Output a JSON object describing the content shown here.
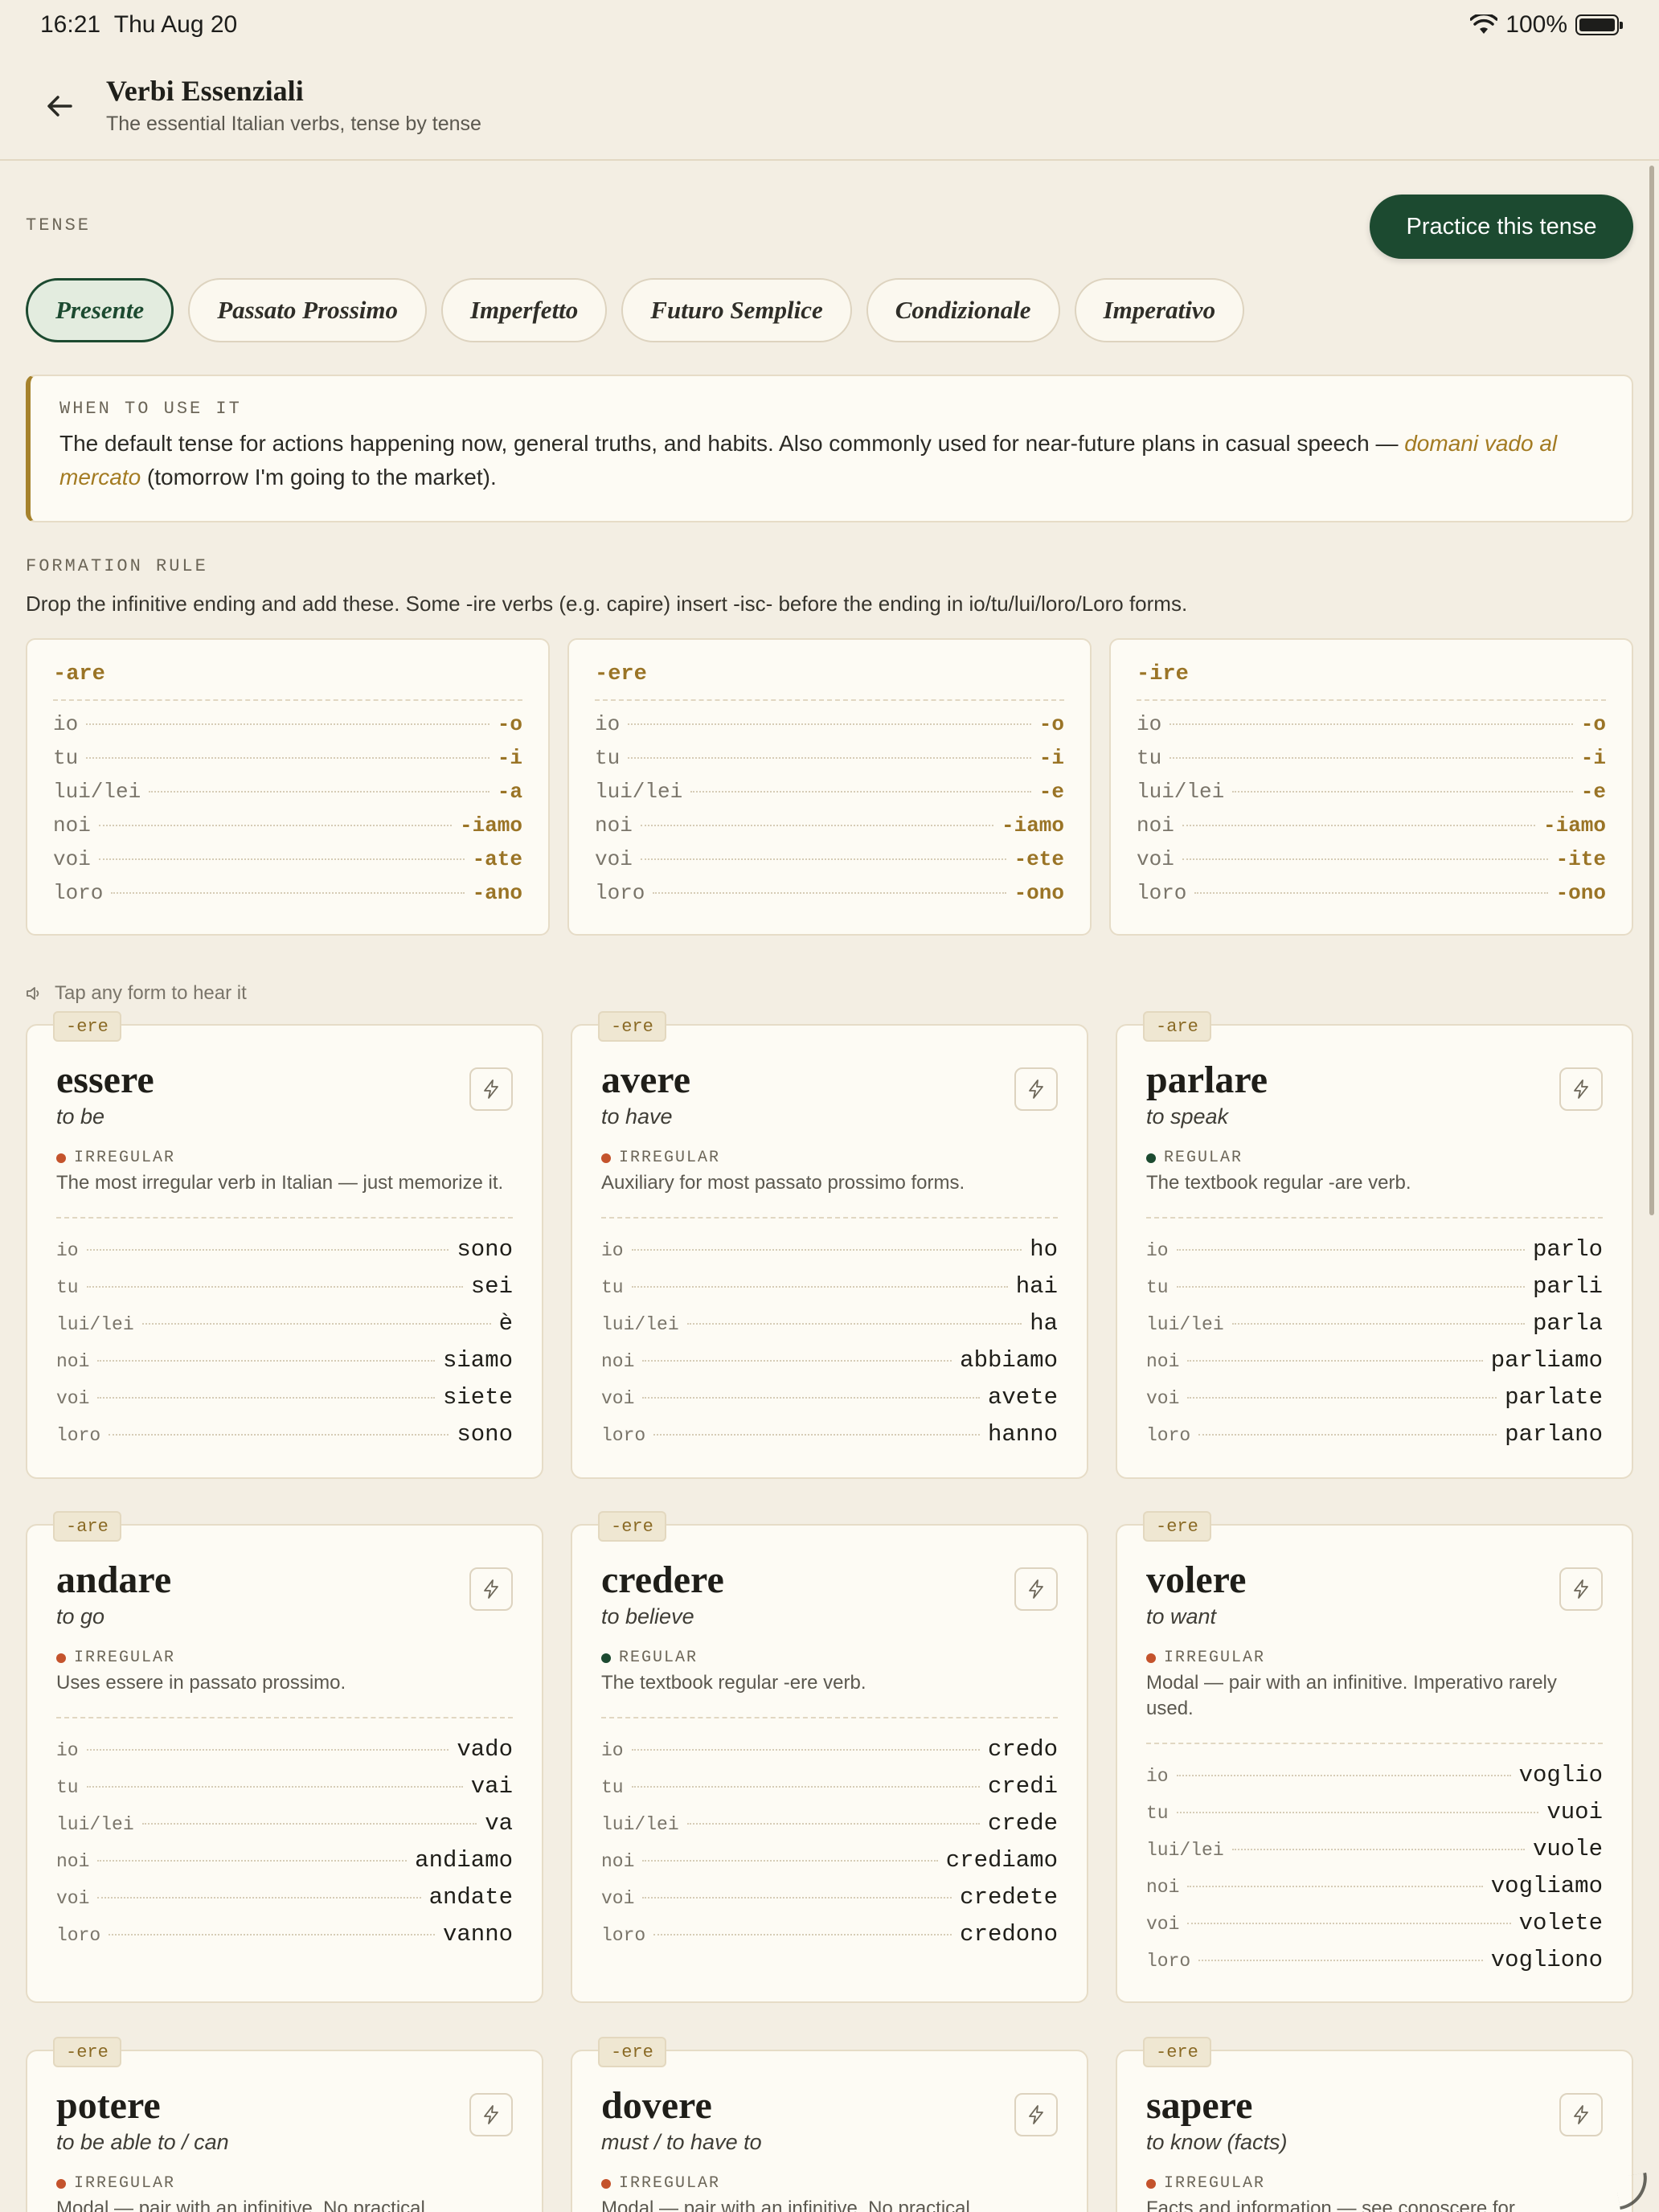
{
  "status_bar": {
    "time": "16:21",
    "date": "Thu Aug 20",
    "battery": "100%"
  },
  "header": {
    "title": "Verbi Essenziali",
    "subtitle": "The essential Italian verbs, tense by tense"
  },
  "tense_section": {
    "label": "TENSE",
    "practice_button": "Practice this tense",
    "tabs": [
      "Presente",
      "Passato Prossimo",
      "Imperfetto",
      "Futuro Semplice",
      "Condizionale",
      "Imperativo"
    ],
    "active_tab": "Presente"
  },
  "when_to_use": {
    "label": "WHEN TO USE IT",
    "text": "The default tense for actions happening now, general truths, and habits. Also commonly used for near-future plans in casual speech — ",
    "example": "domani vado al mercato",
    "translation": " (tomorrow I'm going to the market)."
  },
  "formation": {
    "label": "FORMATION RULE",
    "text": "Drop the infinitive ending and add these. Some -ire verbs (e.g. capire) insert -isc- before the ending in io/tu/lui/loro/Loro forms.",
    "groups": [
      {
        "title": "-are",
        "rows": [
          [
            "io",
            "-o"
          ],
          [
            "tu",
            "-i"
          ],
          [
            "lui/lei",
            "-a"
          ],
          [
            "noi",
            "-iamo"
          ],
          [
            "voi",
            "-ate"
          ],
          [
            "loro",
            "-ano"
          ]
        ]
      },
      {
        "title": "-ere",
        "rows": [
          [
            "io",
            "-o"
          ],
          [
            "tu",
            "-i"
          ],
          [
            "lui/lei",
            "-e"
          ],
          [
            "noi",
            "-iamo"
          ],
          [
            "voi",
            "-ete"
          ],
          [
            "loro",
            "-ono"
          ]
        ]
      },
      {
        "title": "-ire",
        "rows": [
          [
            "io",
            "-o"
          ],
          [
            "tu",
            "-i"
          ],
          [
            "lui/lei",
            "-e"
          ],
          [
            "noi",
            "-iamo"
          ],
          [
            "voi",
            "-ite"
          ],
          [
            "loro",
            "-ono"
          ]
        ]
      }
    ]
  },
  "tap_hint": "Tap any form to hear it",
  "verbs": [
    {
      "tag": "-ere",
      "infinitive": "essere",
      "meaning": "to be",
      "status": "IRREGULAR",
      "regular": false,
      "note": "The most irregular verb in Italian — just memorize it.",
      "forms": [
        [
          "io",
          "sono"
        ],
        [
          "tu",
          "sei"
        ],
        [
          "lui/lei",
          "è"
        ],
        [
          "noi",
          "siamo"
        ],
        [
          "voi",
          "siete"
        ],
        [
          "loro",
          "sono"
        ]
      ]
    },
    {
      "tag": "-ere",
      "infinitive": "avere",
      "meaning": "to have",
      "status": "IRREGULAR",
      "regular": false,
      "note": "Auxiliary for most passato prossimo forms.",
      "forms": [
        [
          "io",
          "ho"
        ],
        [
          "tu",
          "hai"
        ],
        [
          "lui/lei",
          "ha"
        ],
        [
          "noi",
          "abbiamo"
        ],
        [
          "voi",
          "avete"
        ],
        [
          "loro",
          "hanno"
        ]
      ]
    },
    {
      "tag": "-are",
      "infinitive": "parlare",
      "meaning": "to speak",
      "status": "REGULAR",
      "regular": true,
      "note": "The textbook regular -are verb.",
      "forms": [
        [
          "io",
          "parlo"
        ],
        [
          "tu",
          "parli"
        ],
        [
          "lui/lei",
          "parla"
        ],
        [
          "noi",
          "parliamo"
        ],
        [
          "voi",
          "parlate"
        ],
        [
          "loro",
          "parlano"
        ]
      ]
    },
    {
      "tag": "-are",
      "infinitive": "andare",
      "meaning": "to go",
      "status": "IRREGULAR",
      "regular": false,
      "note": "Uses essere in passato prossimo.",
      "forms": [
        [
          "io",
          "vado"
        ],
        [
          "tu",
          "vai"
        ],
        [
          "lui/lei",
          "va"
        ],
        [
          "noi",
          "andiamo"
        ],
        [
          "voi",
          "andate"
        ],
        [
          "loro",
          "vanno"
        ]
      ]
    },
    {
      "tag": "-ere",
      "infinitive": "credere",
      "meaning": "to believe",
      "status": "REGULAR",
      "regular": true,
      "note": "The textbook regular -ere verb.",
      "forms": [
        [
          "io",
          "credo"
        ],
        [
          "tu",
          "credi"
        ],
        [
          "lui/lei",
          "crede"
        ],
        [
          "noi",
          "crediamo"
        ],
        [
          "voi",
          "credete"
        ],
        [
          "loro",
          "credono"
        ]
      ]
    },
    {
      "tag": "-ere",
      "infinitive": "volere",
      "meaning": "to want",
      "status": "IRREGULAR",
      "regular": false,
      "note": "Modal — pair with an infinitive. Imperativo rarely used.",
      "forms": [
        [
          "io",
          "voglio"
        ],
        [
          "tu",
          "vuoi"
        ],
        [
          "lui/lei",
          "vuole"
        ],
        [
          "noi",
          "vogliamo"
        ],
        [
          "voi",
          "volete"
        ],
        [
          "loro",
          "vogliono"
        ]
      ]
    },
    {
      "tag": "-ere",
      "infinitive": "potere",
      "meaning": "to be able to / can",
      "status": "IRREGULAR",
      "regular": false,
      "note": "Modal — pair with an infinitive. No practical",
      "forms": []
    },
    {
      "tag": "-ere",
      "infinitive": "dovere",
      "meaning": "must / to have to",
      "status": "IRREGULAR",
      "regular": false,
      "note": "Modal — pair with an infinitive. No practical",
      "forms": []
    },
    {
      "tag": "-ere",
      "infinitive": "sapere",
      "meaning": "to know (facts)",
      "status": "IRREGULAR",
      "regular": false,
      "note": "Facts and information — see conoscere for",
      "forms": []
    }
  ]
}
